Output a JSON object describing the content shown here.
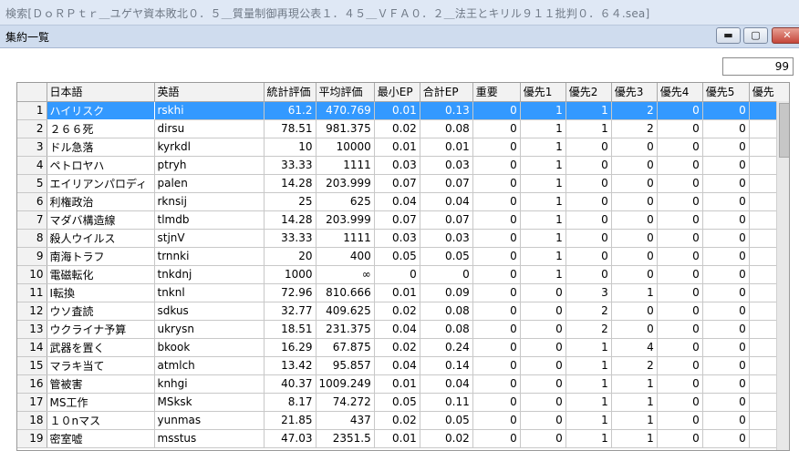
{
  "outer_title": "検索[ＤｏＲＰｔｒ＿ユゲヤ資本敗北０．５＿質量制御再現公表１．４５＿ＶＦＡ０．２＿法王とキリル９１１批判０．６４.sea]",
  "window_title": "集約一覧",
  "controls": {
    "minimize": "▬",
    "maximize": "▢",
    "close": "✕"
  },
  "count_value": "99",
  "columns": [
    "日本語",
    "英語",
    "統計評価",
    "平均評価",
    "最小EP",
    "合計EP",
    "重要",
    "優先1",
    "優先2",
    "優先3",
    "優先4",
    "優先5",
    "優先"
  ],
  "rows": [
    {
      "n": "1",
      "c": [
        "ハイリスク",
        "rskhi",
        "61.2",
        "470.769",
        "0.01",
        "0.13",
        "0",
        "1",
        "1",
        "2",
        "0",
        "0",
        ""
      ]
    },
    {
      "n": "2",
      "c": [
        "２６６死",
        "dirsu",
        "78.51",
        "981.375",
        "0.02",
        "0.08",
        "0",
        "1",
        "1",
        "2",
        "0",
        "0",
        ""
      ]
    },
    {
      "n": "3",
      "c": [
        "ドル急落",
        "kyrkdl",
        "10",
        "10000",
        "0.01",
        "0.01",
        "0",
        "1",
        "0",
        "0",
        "0",
        "0",
        ""
      ]
    },
    {
      "n": "4",
      "c": [
        "ペトロヤハ",
        "ptryh",
        "33.33",
        "1111",
        "0.03",
        "0.03",
        "0",
        "1",
        "0",
        "0",
        "0",
        "0",
        ""
      ]
    },
    {
      "n": "5",
      "c": [
        "エイリアンパロディ",
        "palen",
        "14.28",
        "203.999",
        "0.07",
        "0.07",
        "0",
        "1",
        "0",
        "0",
        "0",
        "0",
        ""
      ]
    },
    {
      "n": "6",
      "c": [
        "利権政治",
        "rknsij",
        "25",
        "625",
        "0.04",
        "0.04",
        "0",
        "1",
        "0",
        "0",
        "0",
        "0",
        ""
      ]
    },
    {
      "n": "7",
      "c": [
        "マダバ構造線",
        "tlmdb",
        "14.28",
        "203.999",
        "0.07",
        "0.07",
        "0",
        "1",
        "0",
        "0",
        "0",
        "0",
        ""
      ]
    },
    {
      "n": "8",
      "c": [
        "殺人ウイルス",
        "stjnV",
        "33.33",
        "1111",
        "0.03",
        "0.03",
        "0",
        "1",
        "0",
        "0",
        "0",
        "0",
        ""
      ]
    },
    {
      "n": "9",
      "c": [
        "南海トラフ",
        "trnnki",
        "20",
        "400",
        "0.05",
        "0.05",
        "0",
        "1",
        "0",
        "0",
        "0",
        "0",
        ""
      ]
    },
    {
      "n": "10",
      "c": [
        "電磁転化",
        "tnkdnj",
        "1000",
        "∞",
        "0",
        "0",
        "0",
        "1",
        "0",
        "0",
        "0",
        "0",
        ""
      ]
    },
    {
      "n": "11",
      "c": [
        "I転換",
        "tnknl",
        "72.96",
        "810.666",
        "0.01",
        "0.09",
        "0",
        "0",
        "3",
        "1",
        "0",
        "0",
        ""
      ]
    },
    {
      "n": "12",
      "c": [
        "ウソ査読",
        "sdkus",
        "32.77",
        "409.625",
        "0.02",
        "0.08",
        "0",
        "0",
        "2",
        "0",
        "0",
        "0",
        ""
      ]
    },
    {
      "n": "13",
      "c": [
        "ウクライナ予算",
        "ukrysn",
        "18.51",
        "231.375",
        "0.04",
        "0.08",
        "0",
        "0",
        "2",
        "0",
        "0",
        "0",
        ""
      ]
    },
    {
      "n": "14",
      "c": [
        "武器を置く",
        "bkook",
        "16.29",
        "67.875",
        "0.02",
        "0.24",
        "0",
        "0",
        "1",
        "4",
        "0",
        "0",
        ""
      ]
    },
    {
      "n": "15",
      "c": [
        "マラキ当て",
        "atmlch",
        "13.42",
        "95.857",
        "0.04",
        "0.14",
        "0",
        "0",
        "1",
        "2",
        "0",
        "0",
        ""
      ]
    },
    {
      "n": "16",
      "c": [
        "管被害",
        "knhgi",
        "40.37",
        "1009.249",
        "0.01",
        "0.04",
        "0",
        "0",
        "1",
        "1",
        "0",
        "0",
        ""
      ]
    },
    {
      "n": "17",
      "c": [
        "MS工作",
        "MSksk",
        "8.17",
        "74.272",
        "0.05",
        "0.11",
        "0",
        "0",
        "1",
        "1",
        "0",
        "0",
        ""
      ]
    },
    {
      "n": "18",
      "c": [
        "１０nマス",
        "yunmas",
        "21.85",
        "437",
        "0.02",
        "0.05",
        "0",
        "0",
        "1",
        "1",
        "0",
        "0",
        ""
      ]
    },
    {
      "n": "19",
      "c": [
        "密室嘘",
        "msstus",
        "47.03",
        "2351.5",
        "0.01",
        "0.02",
        "0",
        "0",
        "1",
        "1",
        "0",
        "0",
        ""
      ]
    }
  ]
}
